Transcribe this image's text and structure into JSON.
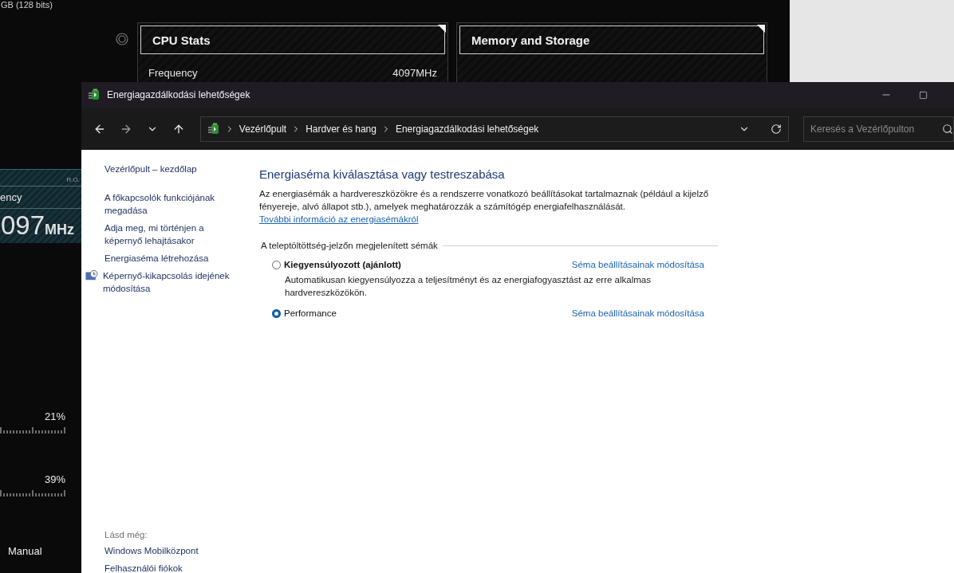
{
  "background_app": {
    "memory_info": "GB (128 bits)",
    "frequency_tile": {
      "tag": "R.O.",
      "label": "ency",
      "value": "097",
      "unit": "MHz"
    },
    "meters": [
      {
        "reading": "21%"
      },
      {
        "reading": "39%"
      }
    ],
    "mode": "Manual",
    "cards": [
      {
        "title": "CPU Stats",
        "rows": [
          {
            "label": "Frequency",
            "value": "4097MHz"
          }
        ]
      },
      {
        "title": "Memory and Storage"
      }
    ]
  },
  "window": {
    "title": "Energiagazdálkodási lehetőségek",
    "breadcrumb": [
      "Vezérlőpult",
      "Hardver és hang",
      "Energiagazdálkodási lehetőségek"
    ],
    "search": {
      "placeholder": "Keresés a Vezérlőpulton"
    }
  },
  "sidebar": {
    "links": [
      {
        "text": "Vezérlőpult – kezdőlap",
        "kind": "home"
      },
      {
        "text": "A főkapcsolók funkciójának megadása",
        "kind": "plain"
      },
      {
        "text": "Adja meg, mi történjen a képernyő lehajtásakor",
        "kind": "plain"
      },
      {
        "text": "Energiaséma létrehozása",
        "kind": "plain"
      },
      {
        "text": "Képernyő-kikapcsolás idejének módosítása",
        "kind": "icon"
      }
    ],
    "see_also": {
      "heading": "Lásd még:",
      "links": [
        "Windows Mobilközpont",
        "Felhasználói fiókok"
      ]
    }
  },
  "main": {
    "heading": "Energiaséma kiválasztása vagy testreszabása",
    "description": "Az energiasémák a hardvereszközökre és a rendszerre vonatkozó beállításokat tartalmaznak (például a kijelző fényereje, alvó állapot stb.), amelyek meghatározzák a számítógép energiafelhasználását.",
    "more_link": "További információ az energiasémákról",
    "group_label": "A teleptöltöttség-jelzőn megjelenített sémák",
    "plans": [
      {
        "name": "Kiegyensúlyozott (ajánlott)",
        "recommended": true,
        "selected": false,
        "description": "Automatikusan kiegyensúlyozza a teljesítményt és az energiafogyasztást az erre alkalmas hardvereszközökön.",
        "settings_link": "Séma beállításainak módosítása"
      },
      {
        "name": "Performance",
        "recommended": false,
        "selected": true,
        "settings_link": "Séma beállításainak módosítása"
      }
    ]
  }
}
